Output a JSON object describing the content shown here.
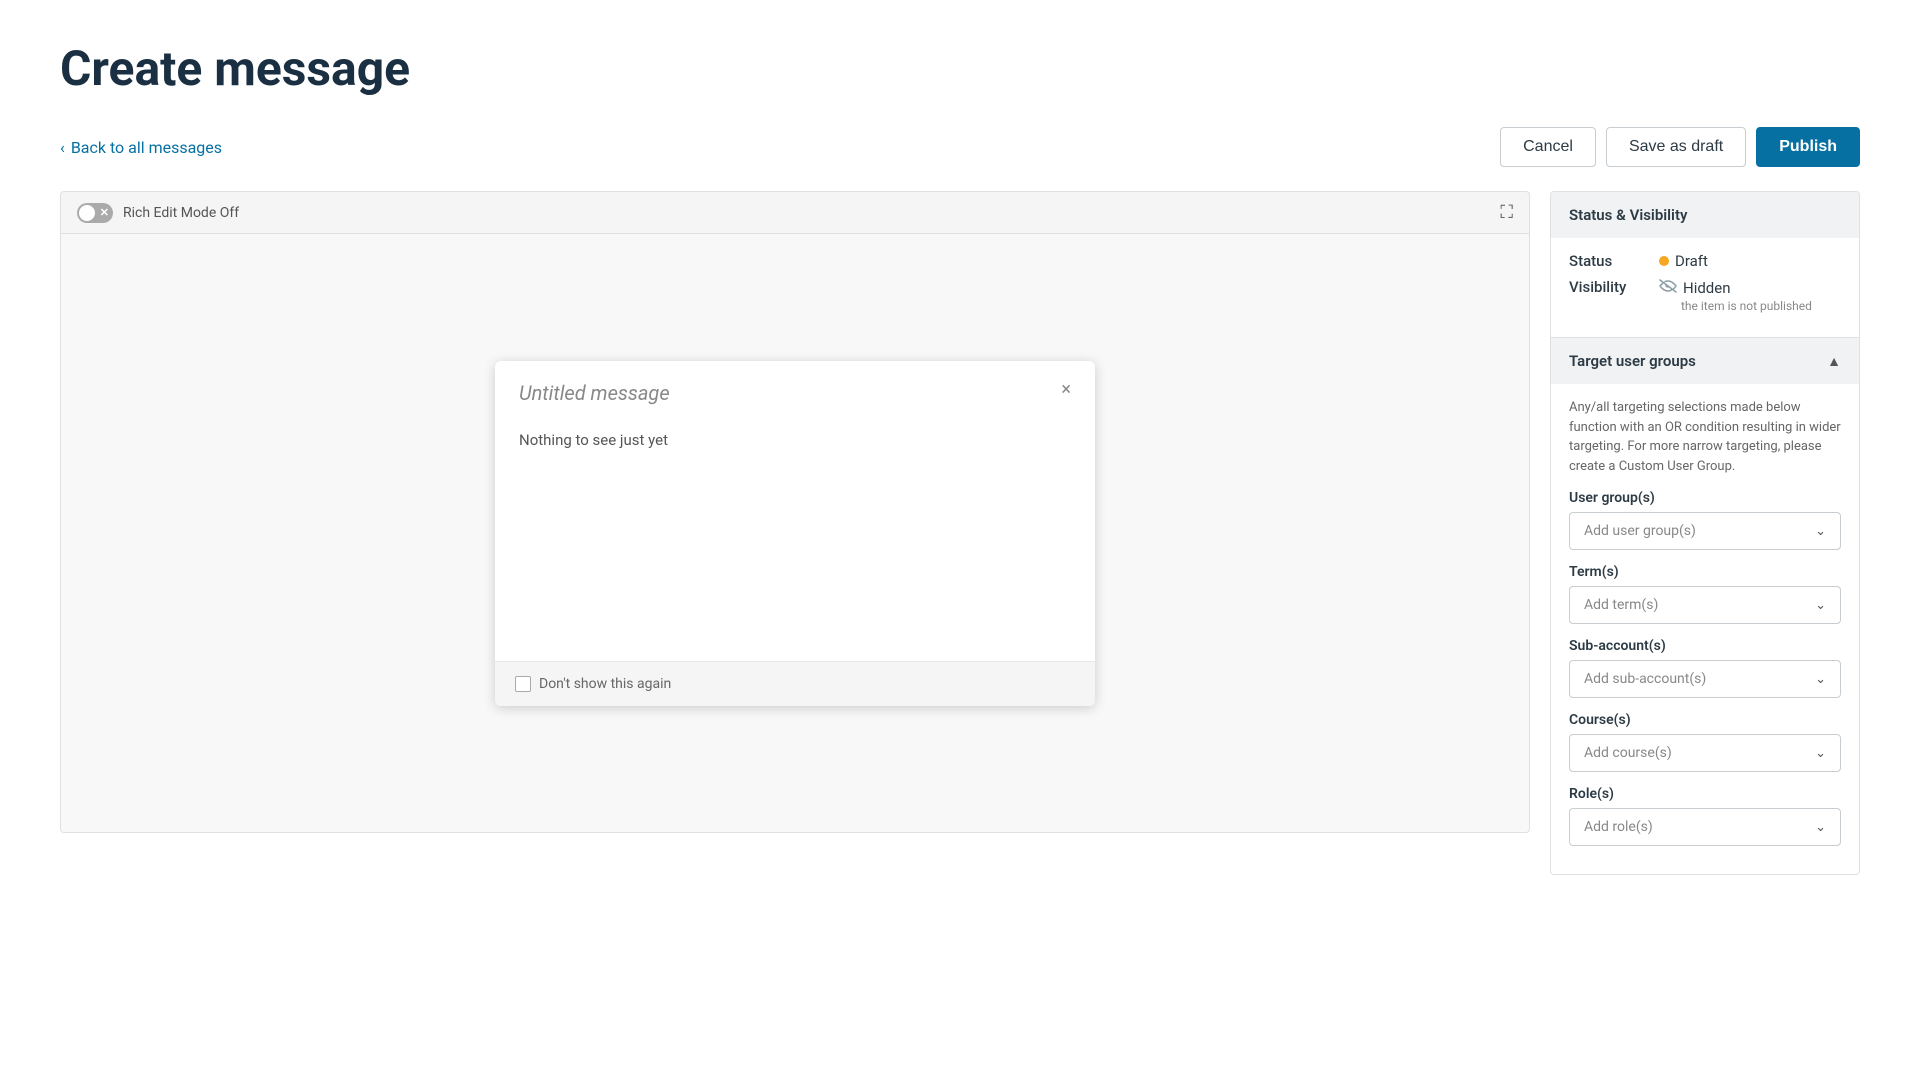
{
  "page": {
    "title": "Create message"
  },
  "nav": {
    "back_label": "Back to all messages"
  },
  "actions": {
    "cancel_label": "Cancel",
    "draft_label": "Save as draft",
    "publish_label": "Publish"
  },
  "editor": {
    "mode_label": "Rich Edit Mode Off",
    "expand_icon": "⛶"
  },
  "preview_card": {
    "title": "Untitled message",
    "body": "Nothing to see just yet",
    "close_icon": "×",
    "dont_show_label": "Don't show this again"
  },
  "sidebar": {
    "status_visibility": {
      "header": "Status & Visibility",
      "status_label": "Status",
      "status_value": "Draft",
      "visibility_label": "Visibility",
      "visibility_value": "Hidden",
      "visibility_sub": "the item is not published"
    },
    "target_groups": {
      "header": "Target user groups",
      "description": "Any/all targeting selections made below function with an OR condition resulting in wider targeting. For more narrow targeting, please create a Custom User Group.",
      "user_group_label": "User group(s)",
      "user_group_placeholder": "Add user group(s)",
      "terms_label": "Term(s)",
      "terms_placeholder": "Add term(s)",
      "subaccount_label": "Sub-account(s)",
      "subaccount_placeholder": "Add sub-account(s)",
      "course_label": "Course(s)",
      "course_placeholder": "Add course(s)",
      "role_label": "Role(s)",
      "role_placeholder": "Add role(s)"
    }
  }
}
